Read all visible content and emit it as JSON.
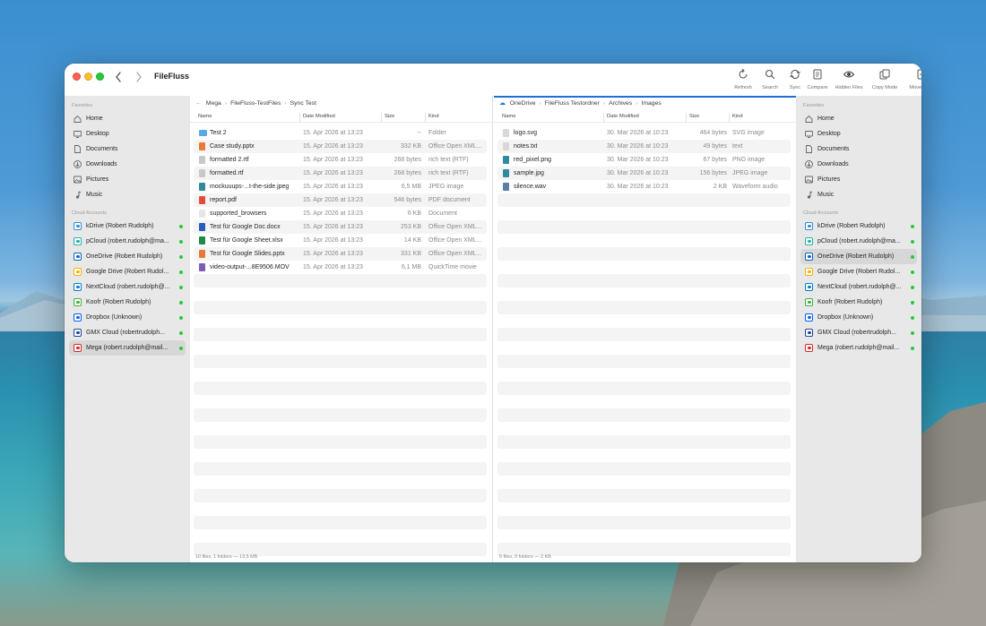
{
  "app": {
    "title": "FileFluss"
  },
  "toolbar": [
    {
      "label": "Refresh",
      "icon": "refresh-icon"
    },
    {
      "label": "Search",
      "icon": "search-icon"
    },
    {
      "label": "Sync",
      "icon": "sync-icon"
    },
    {
      "label": "Compare",
      "icon": "compare-icon"
    },
    {
      "label": "Hidden Files",
      "icon": "eye-icon"
    },
    {
      "label": "Copy Mode",
      "icon": "copy-icon"
    },
    {
      "label": "Move Mode",
      "icon": "move-icon"
    }
  ],
  "sidebar": {
    "favorites_title": "Favorites",
    "favorites": [
      {
        "label": "Home",
        "icon": "house-icon"
      },
      {
        "label": "Desktop",
        "icon": "desktop-icon"
      },
      {
        "label": "Documents",
        "icon": "document-icon"
      },
      {
        "label": "Downloads",
        "icon": "download-icon"
      },
      {
        "label": "Pictures",
        "icon": "picture-icon"
      },
      {
        "label": "Music",
        "icon": "music-note-icon"
      }
    ],
    "cloud_title": "Cloud Accounts",
    "left_cloud": [
      {
        "label": "kDrive (Robert Rudolph)",
        "color": "#2a8dd6"
      },
      {
        "label": "pCloud (robert.rudolph@ma...",
        "color": "#20b2aa"
      },
      {
        "label": "OneDrive (Robert Rudolph)",
        "color": "#0a64c8"
      },
      {
        "label": "Google Drive (Robert Rudol...",
        "color": "#f4b400"
      },
      {
        "label": "NextCloud (robert.rudolph@...",
        "color": "#0082c9"
      },
      {
        "label": "Koofr (Robert Rudolph)",
        "color": "#3cb043"
      },
      {
        "label": "Dropbox (Unknown)",
        "color": "#0061ff"
      },
      {
        "label": "GMX Cloud (robertrudolph...",
        "color": "#1c449b"
      },
      {
        "label": "Mega (robert.rudolph@mail...",
        "color": "#d9272e"
      }
    ],
    "right_cloud": [
      {
        "label": "kDrive (Robert Rudolph)",
        "color": "#2a8dd6"
      },
      {
        "label": "pCloud (robert.rudolph@ma...",
        "color": "#20b2aa"
      },
      {
        "label": "OneDrive (Robert Rudolph)",
        "color": "#0a64c8"
      },
      {
        "label": "Google Drive (Robert Rudol...",
        "color": "#f4b400"
      },
      {
        "label": "NextCloud (robert.rudolph@...",
        "color": "#0082c9"
      },
      {
        "label": "Koofr (Robert Rudolph)",
        "color": "#3cb043"
      },
      {
        "label": "Dropbox (Unknown)",
        "color": "#0061ff"
      },
      {
        "label": "GMX Cloud (robertrudolph...",
        "color": "#1c449b"
      },
      {
        "label": "Mega (robert.rudolph@mail...",
        "color": "#d9272e"
      }
    ]
  },
  "left_pane": {
    "breadcrumb": [
      "Mega",
      "FileFluss-TestFiles",
      "Sync Test"
    ],
    "columns": [
      "Name",
      "Date Modified",
      "Size",
      "Kind"
    ],
    "files": [
      {
        "name": "Test 2",
        "date": "15. Apr 2026 at 13:23",
        "size": "--",
        "kind": "Folder",
        "icon_color": "#5aa9e6"
      },
      {
        "name": "Case study.pptx",
        "date": "15. Apr 2026 at 13:23",
        "size": "332 KB",
        "kind": "Office Open XML...",
        "icon_color": "#e8793a"
      },
      {
        "name": "formatted 2.rtf",
        "date": "15. Apr 2026 at 13:23",
        "size": "268 bytes",
        "kind": "rich text (RTF)",
        "icon_color": "#c8c8c8"
      },
      {
        "name": "formatted.rtf",
        "date": "15. Apr 2026 at 13:23",
        "size": "268 bytes",
        "kind": "rich text (RTF)",
        "icon_color": "#c8c8c8"
      },
      {
        "name": "mockuuups-...t-the-side.jpeg",
        "date": "15. Apr 2026 at 13:23",
        "size": "6,5 MB",
        "kind": "JPEG image",
        "icon_color": "#2f8a9e"
      },
      {
        "name": "report.pdf",
        "date": "15. Apr 2026 at 13:23",
        "size": "546 bytes",
        "kind": "PDF document",
        "icon_color": "#e34b3b"
      },
      {
        "name": "supported_browsers",
        "date": "15. Apr 2026 at 13:23",
        "size": "6 KB",
        "kind": "Document",
        "icon_color": "#e6e6e6"
      },
      {
        "name": "Test für Google Doc.docx",
        "date": "15. Apr 2026 at 13:23",
        "size": "253 KB",
        "kind": "Office Open XML...",
        "icon_color": "#2b5cb8"
      },
      {
        "name": "Test für Google Sheet.xlsx",
        "date": "15. Apr 2026 at 13:23",
        "size": "14 KB",
        "kind": "Office Open XML...",
        "icon_color": "#1f8a4c"
      },
      {
        "name": "Test für Google Slides.pptx",
        "date": "15. Apr 2026 at 13:23",
        "size": "331 KB",
        "kind": "Office Open XML...",
        "icon_color": "#e8793a"
      },
      {
        "name": "video-output-...8E9506.MOV",
        "date": "15. Apr 2026 at 13:23",
        "size": "6,1 MB",
        "kind": "QuickTime movie",
        "icon_color": "#7a5fb0"
      }
    ],
    "status": "10 files, 1 folders — 13,5 MB"
  },
  "right_pane": {
    "breadcrumb": [
      "OneDrive",
      "FileFluss Testordner",
      "Archives",
      "Images"
    ],
    "columns": [
      "Name",
      "Date Modified",
      "Size",
      "Kind"
    ],
    "files": [
      {
        "name": "logo.svg",
        "date": "30. Mar 2026 at 10:23",
        "size": "464 bytes",
        "kind": "SVG image",
        "icon_color": "#d8d8d8"
      },
      {
        "name": "notes.txt",
        "date": "30. Mar 2026 at 10:23",
        "size": "49 bytes",
        "kind": "text",
        "icon_color": "#d8d8d8"
      },
      {
        "name": "red_pixel.png",
        "date": "30. Mar 2026 at 10:23",
        "size": "67 bytes",
        "kind": "PNG image",
        "icon_color": "#2f8a9e"
      },
      {
        "name": "sample.jpg",
        "date": "30. Mar 2026 at 10:23",
        "size": "156 bytes",
        "kind": "JPEG image",
        "icon_color": "#2f8a9e"
      },
      {
        "name": "silence.wav",
        "date": "30. Mar 2026 at 10:23",
        "size": "2 KB",
        "kind": "Waveform audio",
        "icon_color": "#5a7fa8"
      }
    ],
    "status": "5 files, 0 folders — 2 KB"
  }
}
